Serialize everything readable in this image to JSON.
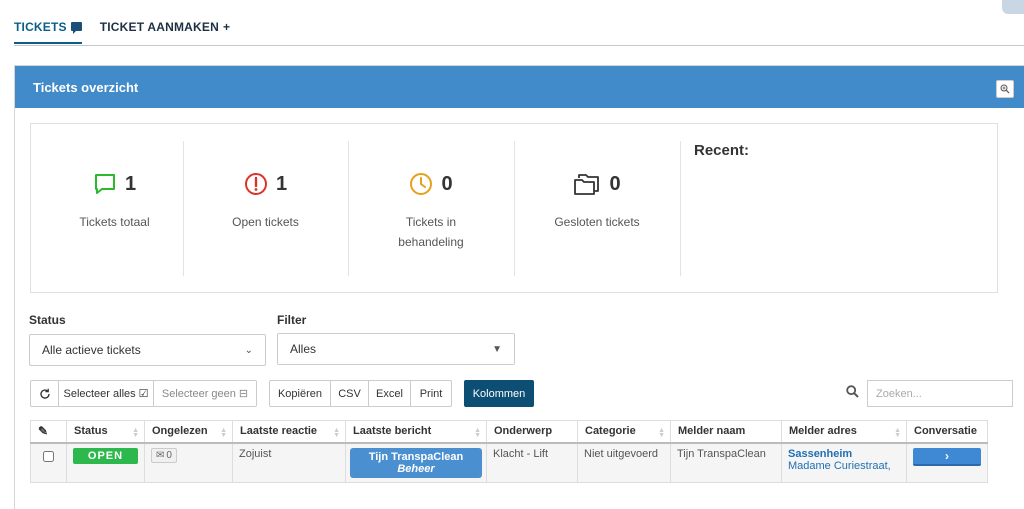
{
  "tabs": [
    {
      "label": "TICKETS",
      "icon": "speech-bubble-icon",
      "active": true
    },
    {
      "label": "TICKET AANMAKEN",
      "icon": "plus-icon",
      "active": false
    }
  ],
  "panel": {
    "title": "Tickets overzicht"
  },
  "stats": [
    {
      "icon": "chat-bubble-icon",
      "color": "#2eb82e",
      "value": "1",
      "label": "Tickets totaal"
    },
    {
      "icon": "exclamation-circle-icon",
      "color": "#d9342b",
      "value": "1",
      "label": "Open tickets"
    },
    {
      "icon": "clock-icon",
      "color": "#e6a11a",
      "value": "0",
      "label": "Tickets in behandeling"
    },
    {
      "icon": "folder-icon",
      "color": "#333333",
      "value": "0",
      "label": "Gesloten tickets"
    }
  ],
  "recent": {
    "title": "Recent:"
  },
  "filters": {
    "status_label": "Status",
    "status_value": "Alle actieve tickets",
    "filter_label": "Filter",
    "filter_value": "Alles"
  },
  "toolbar": {
    "refresh_icon": "refresh-icon",
    "select_all": "Selecteer alles",
    "select_none": "Selecteer geen",
    "copy": "Kopiëren",
    "csv": "CSV",
    "excel": "Excel",
    "print": "Print",
    "columns": "Kolommen",
    "search_placeholder": "Zoeken..."
  },
  "table": {
    "columns": [
      "",
      "Status",
      "Ongelezen",
      "Laatste reactie",
      "Laatste bericht",
      "Onderwerp",
      "Categorie",
      "Melder naam",
      "Melder adres",
      "Conversatie"
    ],
    "rows": [
      {
        "status": "OPEN",
        "unread": "0",
        "last_reaction": "Zojuist",
        "last_message_name": "Tijn TranspaClean",
        "last_message_role": "Beheer",
        "subject": "Klacht - Lift",
        "category": "Niet uitgevoerd",
        "reporter_name": "Tijn TranspaClean",
        "reporter_address_name": "Sassenheim",
        "reporter_address_street": "Madame Curiestraat,",
        "conversation_label": "›"
      }
    ]
  },
  "colors": {
    "header": "#428bca",
    "columns_button": "#0d4e74",
    "status_open": "#2db84d"
  }
}
